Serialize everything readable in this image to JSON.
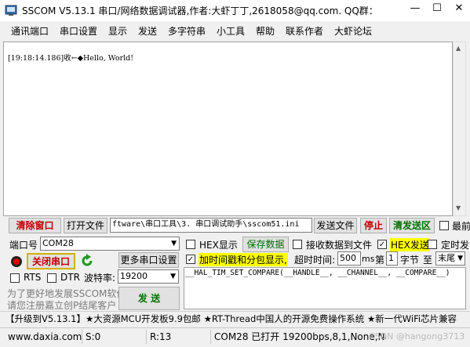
{
  "window": {
    "title": "SSCOM V5.13.1 串口/网络数据调试器,作者:大虾丁丁,2618058@qq.com. QQ群：",
    "minimize": "—",
    "maximize": "☐",
    "close": "✕"
  },
  "menu": [
    "通讯端口",
    "串口设置",
    "显示",
    "发送",
    "多字符串",
    "小工具",
    "帮助",
    "联系作者",
    "大虾论坛"
  ],
  "receive": {
    "log": "[19:18:14.186]收←◆Hello, World!"
  },
  "toolbar1": {
    "clear_window": "清除窗口",
    "open_file": "打开文件",
    "file_path": "ftware\\串口工具\\3. 串口调试助手\\sscom51.ini",
    "send_file": "发送文件",
    "stop": "停止",
    "clear_send": "清发送区",
    "top_label": "最前"
  },
  "port": {
    "port_label": "端口号",
    "port_value": "COM28",
    "close_port": "关闭串口",
    "more_settings": "更多串口设置",
    "rts_label": "RTS",
    "dtr_label": "DTR",
    "baud_label": "波特率:",
    "baud_value": "19200"
  },
  "options": {
    "hex_display": "HEX显示",
    "save_data": "保存数据",
    "recv_to_file": "接收数据到文件",
    "hex_send": "HEX发送",
    "timed_send": "定时发",
    "add_timestamp": "加时间戳和分包显示,",
    "timeout_label": "超时时间:",
    "timeout_value": "500",
    "ms": "ms",
    "nth_label": "第",
    "nth_value": "1",
    "byte_label": "字节",
    "to_label": "至",
    "end_value": "末尾"
  },
  "send": {
    "text": "__HAL_TIM_SET_COMPARE(__HANDLE__, __CHANNEL__, __COMPARE__)",
    "send_button": "发 送"
  },
  "promo": {
    "line1": "为了更好地发展SSCOM软件",
    "line2": "请您注册嘉立创P结尾客户",
    "ticker": "【升级到V5.13.1】★大资源MCU开发板9.9包邮 ★RT-Thread中国人的开源免费操作系统 ★新一代WiFi芯片兼容"
  },
  "status": {
    "website": "www.daxia.com",
    "s_count": "S:0",
    "r_count": "R:13",
    "port_status": "COM28 已打开  19200bps,8,1,None,None",
    "watermark": "CSDN @hangong3713"
  },
  "colors": {
    "accent_red": "#c00000",
    "accent_green": "#007000",
    "highlight_yellow": "#ffff00"
  }
}
